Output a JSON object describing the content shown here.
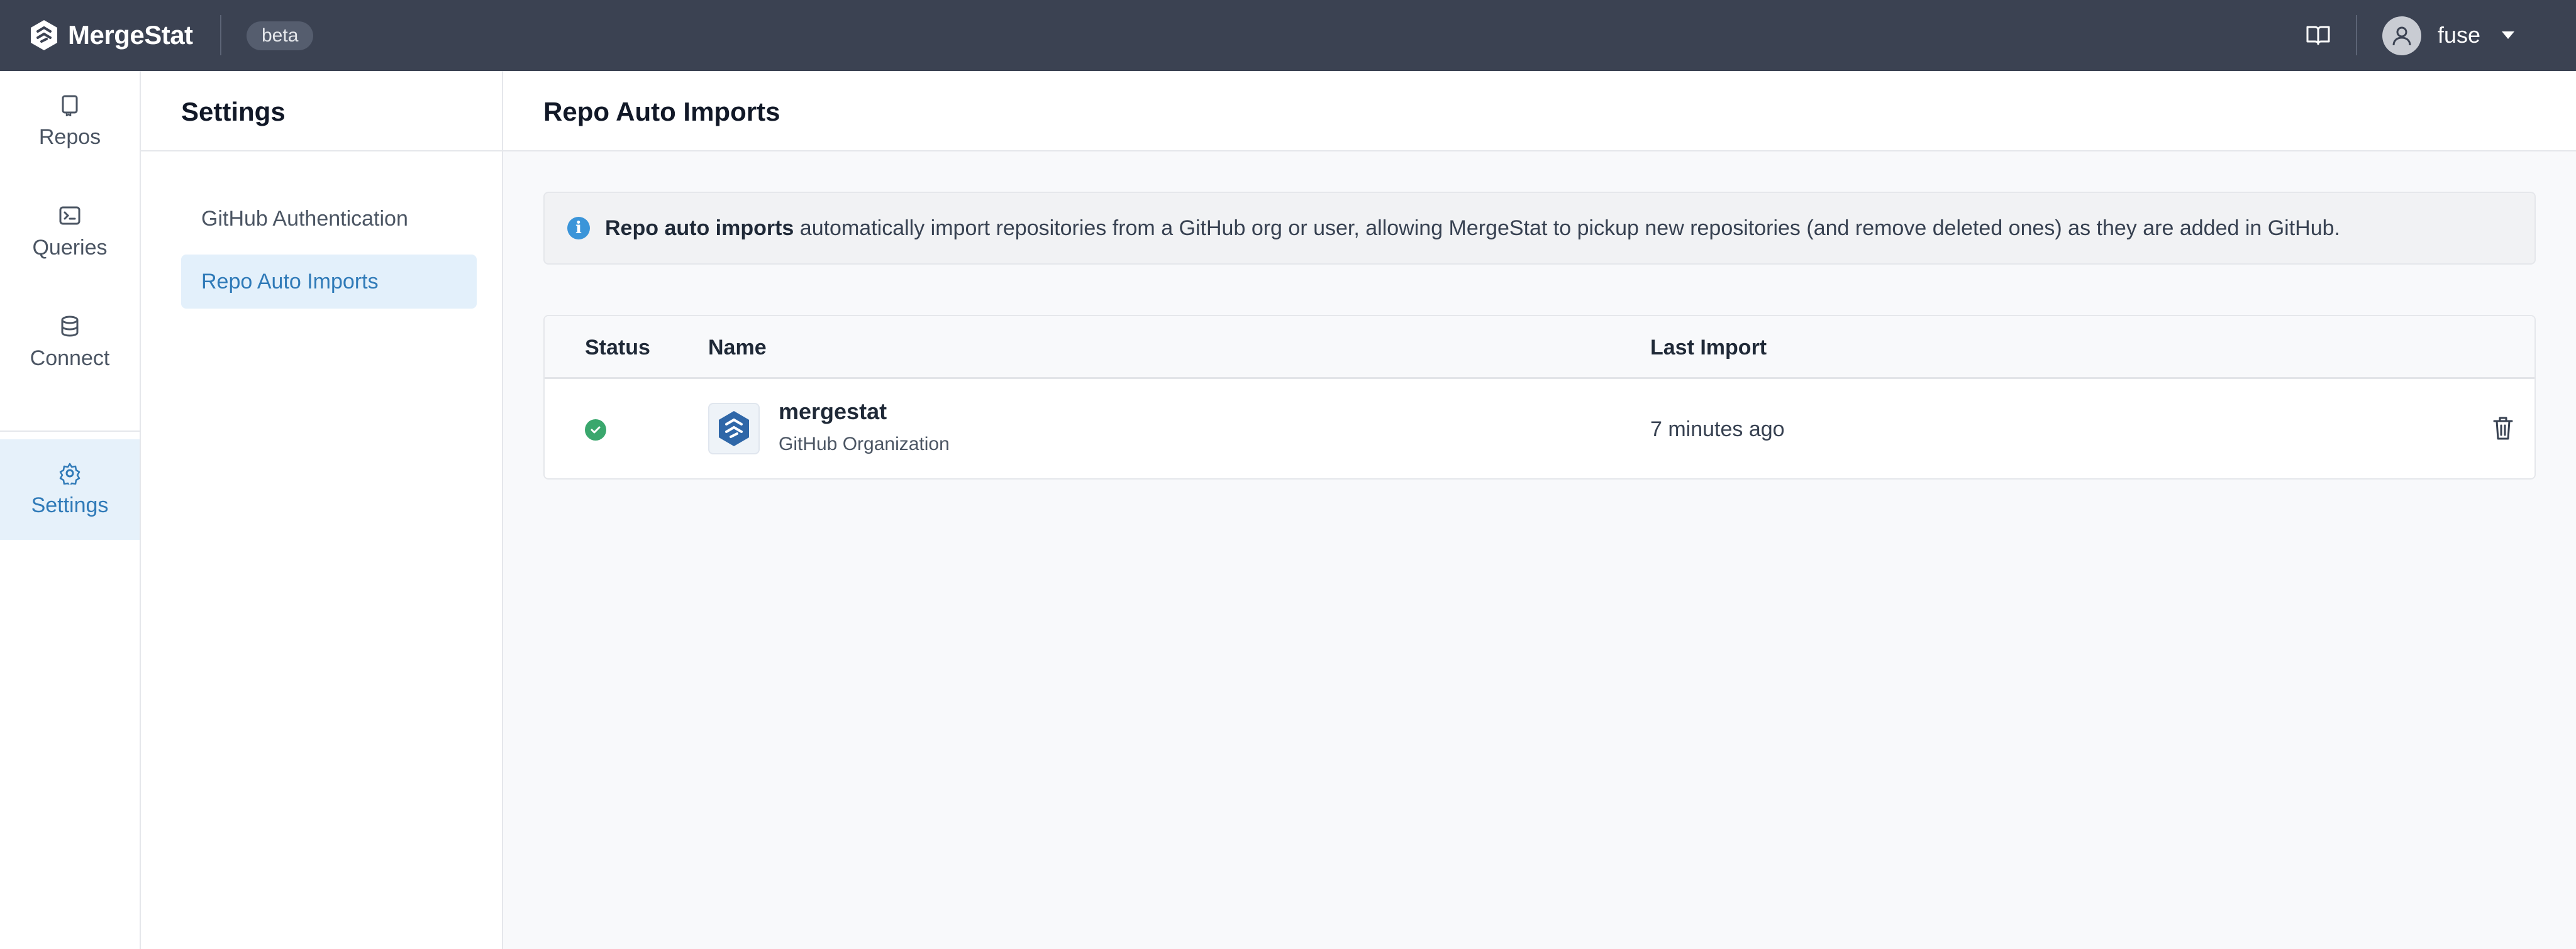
{
  "app": {
    "brand": "MergeStat",
    "badge": "beta",
    "user": "fuse"
  },
  "rail": {
    "items": [
      {
        "label": "Repos",
        "icon": "book-icon"
      },
      {
        "label": "Queries",
        "icon": "terminal-icon"
      },
      {
        "label": "Connect",
        "icon": "database-icon"
      },
      {
        "label": "Settings",
        "icon": "gear-icon",
        "active": true
      }
    ]
  },
  "subnav": {
    "title": "Settings",
    "items": [
      {
        "label": "GitHub Authentication"
      },
      {
        "label": "Repo Auto Imports",
        "active": true
      }
    ]
  },
  "main": {
    "title": "Repo Auto Imports",
    "info": {
      "bold": "Repo auto imports",
      "text": " automatically import repositories from a GitHub org or user, allowing MergeStat to pickup new repositories (and remove deleted ones) as they are added in GitHub."
    },
    "table": {
      "columns": [
        "Status",
        "Name",
        "Last Import"
      ],
      "rows": [
        {
          "status": "success",
          "name": "mergestat",
          "type": "GitHub Organization",
          "last_import": "7 minutes ago"
        }
      ]
    }
  },
  "colors": {
    "topbar": "#3b4252",
    "accent": "#2f7ab8",
    "success": "#3aa76d",
    "info": "#3b95d9"
  }
}
